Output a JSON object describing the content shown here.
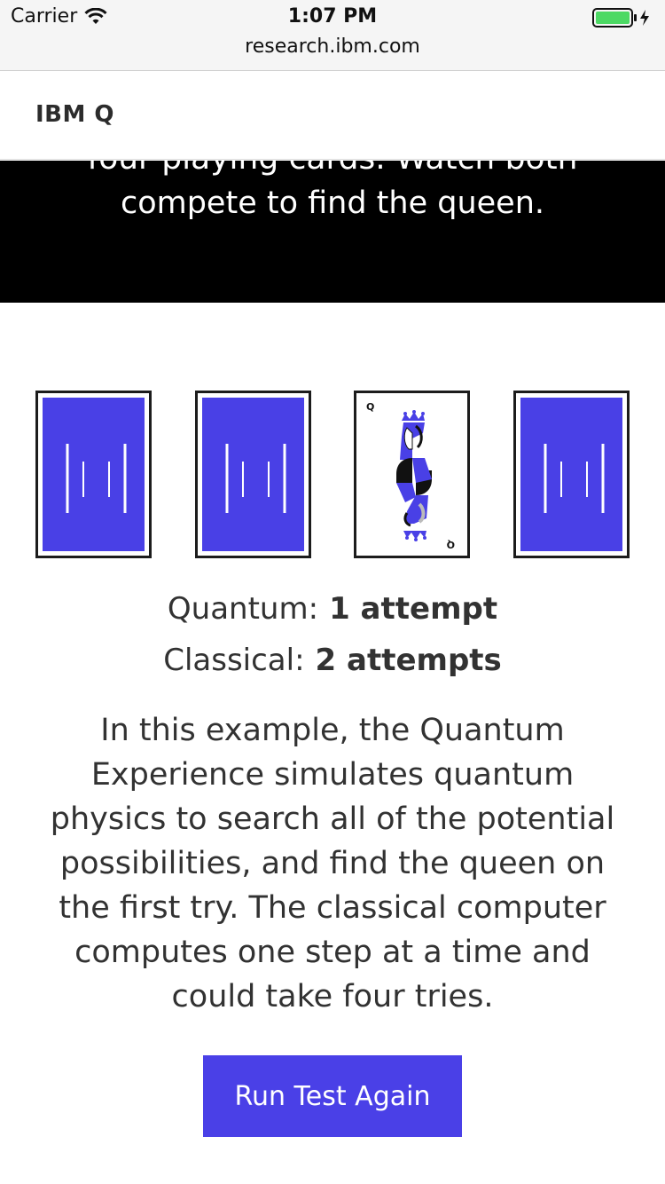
{
  "status_bar": {
    "carrier": "Carrier",
    "time": "1:07 PM",
    "battery_icon": "battery-charging-icon",
    "wifi_icon": "wifi-icon"
  },
  "browser": {
    "url": "research.ibm.com"
  },
  "nav": {
    "brand": "IBM Q"
  },
  "hero": {
    "partial_line": "four playing cards. Watch both",
    "line": "compete to find the queen."
  },
  "cards": [
    {
      "type": "back",
      "icon": "card-back-icon"
    },
    {
      "type": "back",
      "icon": "card-back-icon"
    },
    {
      "type": "queen",
      "icon": "queen-card-icon",
      "rank": "Q"
    },
    {
      "type": "back",
      "icon": "card-back-icon"
    }
  ],
  "results": {
    "quantum_label": "Quantum:",
    "quantum_value": "1 attempt",
    "classical_label": "Classical:",
    "classical_value": "2 attempts"
  },
  "description": "In this example, the Quantum Experience simulates quantum physics to search all of the potential possibilities, and find the queen on the first try. The classical computer computes one step at a time and could take four tries.",
  "actions": {
    "run_again": "Run Test Again"
  },
  "colors": {
    "accent": "#4a40e7",
    "hero_bg": "#000000",
    "text": "#323232"
  }
}
